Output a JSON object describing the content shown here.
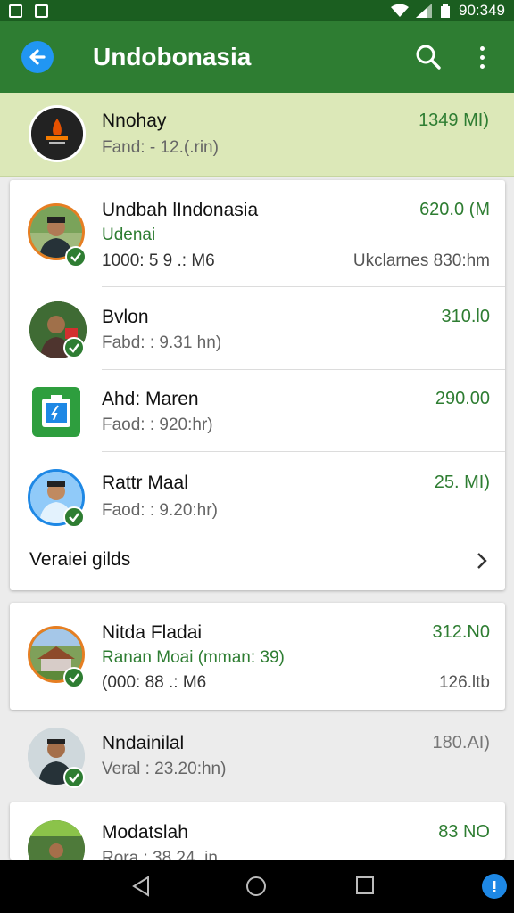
{
  "status_bar": {
    "time": "90:349"
  },
  "app_bar": {
    "title": "Undobonasia"
  },
  "highlight_item": {
    "name": "Nnohay",
    "subtitle": "Fand: - 12.(.rin)",
    "amount": "1349 MI)"
  },
  "group1": {
    "items": [
      {
        "name": "Undbah lIndonasia",
        "sub1": "Udenai",
        "sub2": "1000: 5 9 .: M6",
        "meta_right": "Ukclarnes 830:hm",
        "amount": "620.0 (M"
      },
      {
        "name": "Bvlon",
        "sub1": "Fabd: : 9.31 hn)",
        "amount": "310.l0"
      },
      {
        "name": "Ahd: Maren",
        "sub1": "Faod: : 920:hr)",
        "amount": "290.00"
      },
      {
        "name": "Rattr Maal",
        "sub1": "Faod: : 9.20:hr)",
        "amount": "25. MI)"
      }
    ],
    "view_more_label": "Veraiei gilds"
  },
  "group2": {
    "items": [
      {
        "name": "Nitda Fladai",
        "sub1": "Ranan Moai (mman: 39)",
        "sub2": "(000: 88 .: M6",
        "meta_right": "126.ltb",
        "amount": "312.N0"
      }
    ]
  },
  "loose_item": {
    "name": "Nndainilal",
    "sub1": "Veral : 23.20:hn)",
    "amount": "180.AI)"
  },
  "group3": {
    "items": [
      {
        "name": "Modatslah",
        "sub1": "Rora : 38 24 .in",
        "amount": "83 NO"
      }
    ]
  },
  "colors": {
    "primary": "#2e7d32",
    "primary_dark": "#1b5e20",
    "highlight": "#dce8b8",
    "accent": "#2196f3"
  },
  "icons": [
    "back-arrow-icon",
    "search-icon",
    "more-vert-icon",
    "verified-check-icon",
    "chevron-right-icon",
    "nav-back-icon",
    "nav-home-icon",
    "nav-recents-icon"
  ]
}
